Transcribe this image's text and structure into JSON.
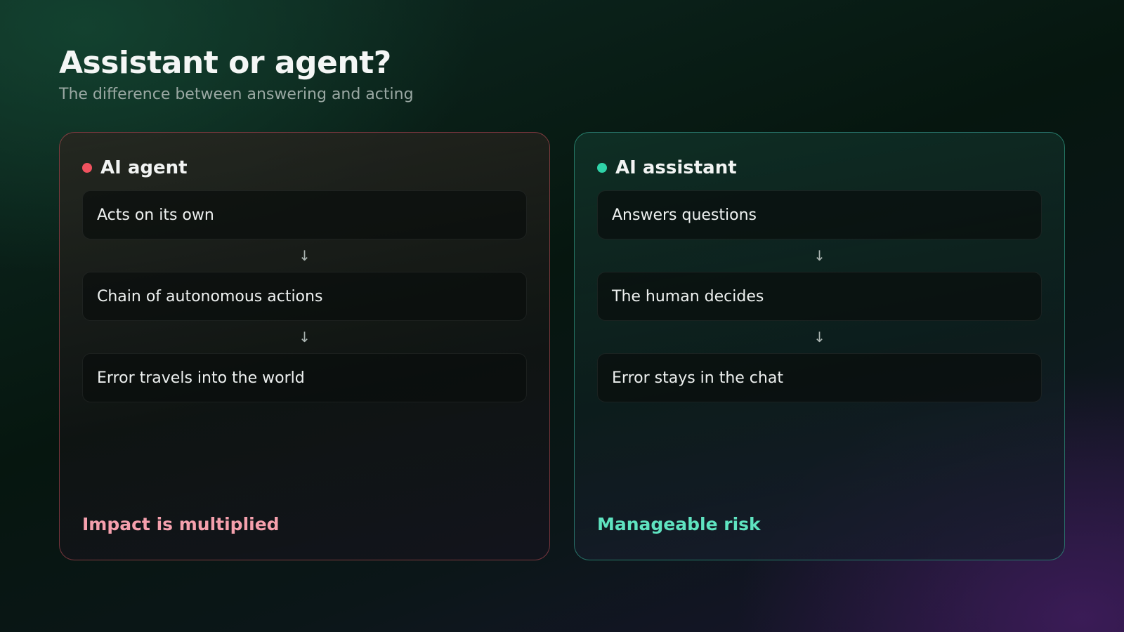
{
  "header": {
    "title": "Assistant or agent?",
    "subtitle": "The difference between answering and acting"
  },
  "colors": {
    "agent_accent": "#f0525f",
    "agent_outcome": "#f5a0ad",
    "assistant_accent": "#2fd3a8",
    "assistant_outcome": "#5fe3c0"
  },
  "agent": {
    "title": "AI agent",
    "steps": [
      "Acts on its own",
      "Chain of autonomous actions",
      "Error travels into the world"
    ],
    "arrow": "↓",
    "outcome": "Impact is multiplied"
  },
  "assistant": {
    "title": "AI assistant",
    "steps": [
      "Answers questions",
      "The human decides",
      "Error stays in the chat"
    ],
    "arrow": "↓",
    "outcome": "Manageable risk"
  }
}
